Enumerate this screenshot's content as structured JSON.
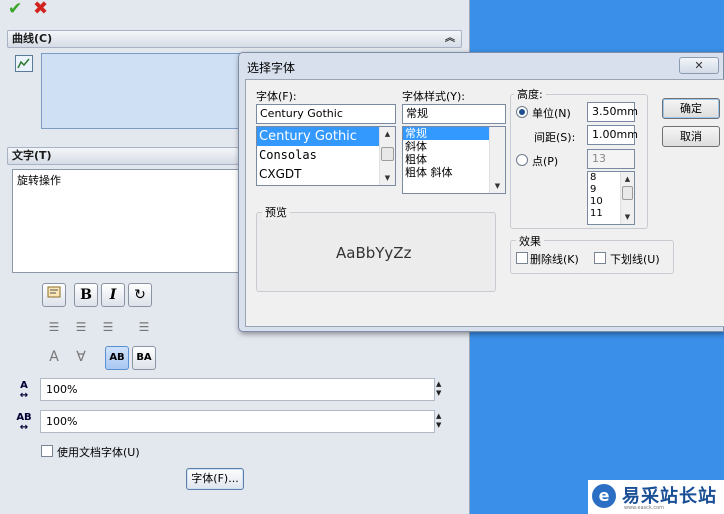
{
  "property_manager": {
    "curve_group": {
      "title": "曲线(C)"
    },
    "text_group": {
      "title": "文字(T)",
      "text_value": "旋转操作"
    },
    "width_factor": "100%",
    "spacing_factor": "100%",
    "use_doc_font_label": "使用文档字体(U)",
    "font_button_label": "字体(F)..."
  },
  "dialog": {
    "title": "选择字体",
    "close_glyph": "✕",
    "font_label": "字体(F):",
    "font_value": "Century Gothic",
    "font_list": [
      "Century Gothic",
      "Consolas",
      "CXGDT"
    ],
    "style_label": "字体样式(Y):",
    "style_value": "常规",
    "style_list": [
      "常规",
      "斜体",
      "粗体",
      "粗体 斜体"
    ],
    "height_label": "高度:",
    "unit_label": "单位(N)",
    "unit_value": "3.50mm",
    "spacing_label": "间距(S):",
    "spacing_value": "1.00mm",
    "point_label": "点(P)",
    "point_value": "13",
    "point_list": [
      "8",
      "9",
      "10",
      "11"
    ],
    "preview_label": "预览",
    "preview_text": "AaBbYyZz",
    "effects_label": "效果",
    "strikeout_label": "删除线(K)",
    "underline_label": "下划线(U)",
    "ok_label": "确定",
    "cancel_label": "取消"
  },
  "watermark": {
    "logo": "e",
    "text": "易采站长站",
    "url": "www.easck.com"
  },
  "colors": {
    "desktop": "#3a8fe8",
    "selection": "#3399ff",
    "ok_check": "#3aa52a",
    "cancel_x": "#d2231e"
  }
}
